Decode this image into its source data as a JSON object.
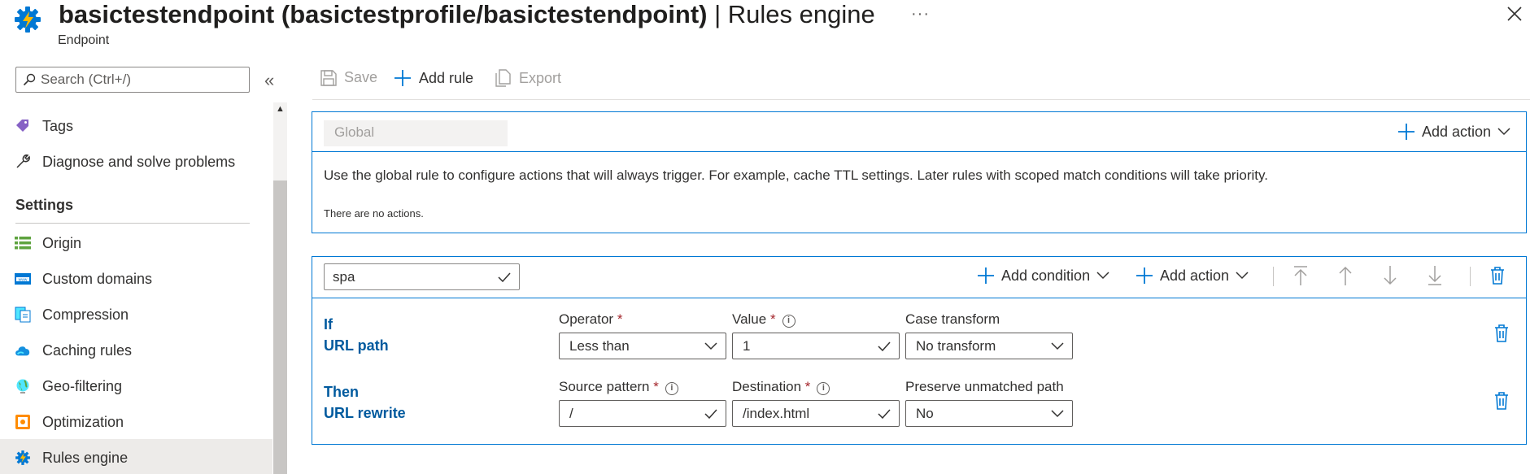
{
  "header": {
    "title_bold": "basictestendpoint (basictestprofile/basictestendpoint)",
    "title_rest": " | Rules engine",
    "subtitle": "Endpoint",
    "more": "···"
  },
  "sidebar": {
    "search_placeholder": "Search (Ctrl+/)",
    "collapse": "«",
    "items_top": [
      {
        "label": "Tags",
        "icon": "tag-icon"
      },
      {
        "label": "Diagnose and solve problems",
        "icon": "wrench-icon"
      }
    ],
    "settings_header": "Settings",
    "items": [
      {
        "label": "Origin",
        "icon": "origin-icon"
      },
      {
        "label": "Custom domains",
        "icon": "www-icon"
      },
      {
        "label": "Compression",
        "icon": "compression-icon"
      },
      {
        "label": "Caching rules",
        "icon": "cloud-icon"
      },
      {
        "label": "Geo-filtering",
        "icon": "globe-icon"
      },
      {
        "label": "Optimization",
        "icon": "optimization-icon"
      },
      {
        "label": "Rules engine",
        "icon": "gear-bolt-icon",
        "active": true
      }
    ]
  },
  "toolbar": {
    "save": "Save",
    "add_rule": "Add rule",
    "export": "Export"
  },
  "global_rule": {
    "name": "Global",
    "add_action": "Add action",
    "description": "Use the global rule to configure actions that will always trigger. For example, cache TTL settings. Later rules with scoped match conditions will take priority.",
    "no_actions": "There are no actions."
  },
  "rule": {
    "name": "spa",
    "add_condition": "Add condition",
    "add_action": "Add action",
    "condition": {
      "keyword": "If",
      "type": "URL path",
      "operator_label": "Operator",
      "operator_value": "Less than",
      "value_label": "Value",
      "value_value": "1",
      "case_label": "Case transform",
      "case_value": "No transform"
    },
    "action": {
      "keyword": "Then",
      "type": "URL rewrite",
      "source_label": "Source pattern",
      "source_value": "/",
      "dest_label": "Destination",
      "dest_value": "/index.html",
      "preserve_label": "Preserve unmatched path",
      "preserve_value": "No"
    },
    "required_mark": "*",
    "info_mark": "i"
  },
  "colors": {
    "accent": "#0078d4",
    "link_dark": "#005a9e",
    "required": "#a4262c",
    "active_bg": "#edebe9"
  }
}
